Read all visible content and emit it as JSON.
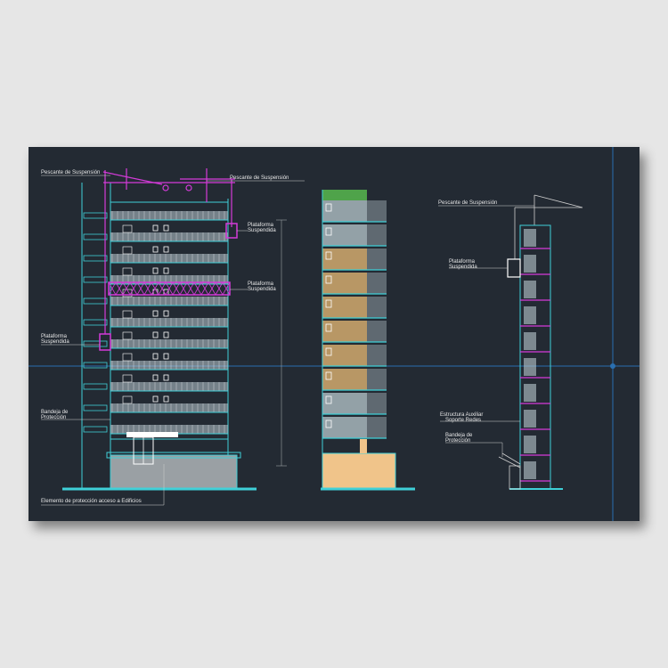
{
  "colors": {
    "background": "#e6e6e6",
    "sheet": "#232a33",
    "structure": "#3fd0d8",
    "equipment": "#d43bd9",
    "axis": "#2a6fb0",
    "label": "#e8e8e8",
    "glass": "#b9c9cf",
    "brick": "#c9a36a",
    "ground": "#f0c48a",
    "roof": "#4fa34a"
  },
  "drawing": {
    "front_elevation": {
      "labels": {
        "pescante_left": "Pescante de Suspensión",
        "pescante_top": "Pescante de Suspensión",
        "plataforma_right_1": "Plataforma",
        "plataforma_right_1b": "Suspendida",
        "plataforma_right_2": "Plataforma",
        "plataforma_right_2b": "Suspendida",
        "plataforma_left_1": "Plataforma",
        "plataforma_left_1b": "Suspendida",
        "bandeja_1": "Bandeja de",
        "bandeja_1b": "Protección",
        "elemento": "Elemento de protección acceso a Edificios"
      }
    },
    "side_elevation": {
      "labels": {
        "pescante": "Pescante de Suspensión",
        "plataforma": "Plataforma",
        "plataforma_b": "Suspendida",
        "estructura": "Estructura Auxiliar",
        "estructura_b": "Soporte Redes",
        "bandeja": "Bandeja de",
        "bandeja_b": "Protección"
      }
    }
  }
}
